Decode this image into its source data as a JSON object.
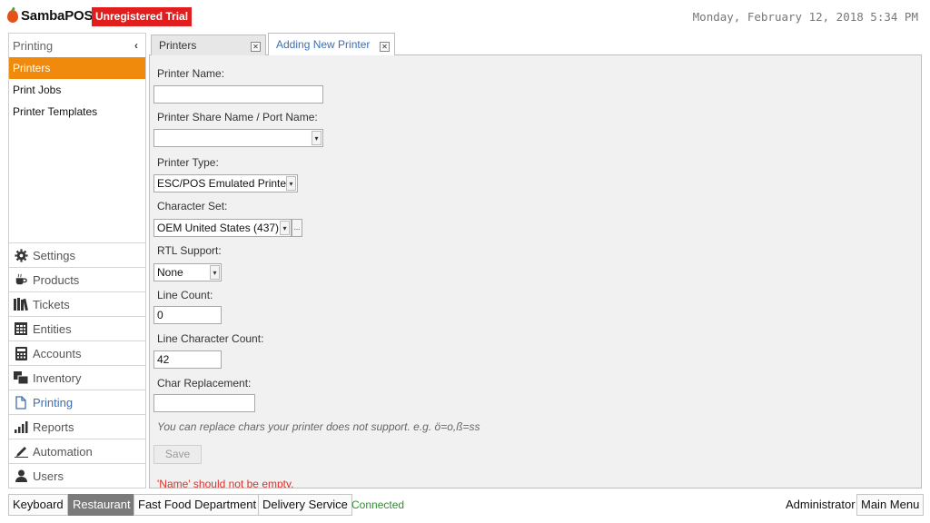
{
  "app": {
    "logo_text": "SambaPOS",
    "trial_badge": "Unregistered Trial",
    "datetime": "Monday, February 12, 2018 5:34 PM"
  },
  "sidebar": {
    "title": "Printing",
    "collapse_icon": "chevron-left",
    "items": [
      {
        "label": "Printers",
        "active": true
      },
      {
        "label": "Print Jobs",
        "active": false
      },
      {
        "label": "Printer Templates",
        "active": false
      }
    ],
    "categories": [
      {
        "label": "Settings",
        "icon": "gear-icon"
      },
      {
        "label": "Products",
        "icon": "coffee-cup-icon"
      },
      {
        "label": "Tickets",
        "icon": "books-icon"
      },
      {
        "label": "Entities",
        "icon": "table-grid-icon"
      },
      {
        "label": "Accounts",
        "icon": "calculator-icon"
      },
      {
        "label": "Inventory",
        "icon": "boxes-icon"
      },
      {
        "label": "Printing",
        "icon": "document-icon"
      },
      {
        "label": "Reports",
        "icon": "bar-chart-icon"
      },
      {
        "label": "Automation",
        "icon": "pen-icon"
      },
      {
        "label": "Users",
        "icon": "user-icon"
      }
    ]
  },
  "tabs": [
    {
      "label": "Printers"
    },
    {
      "label": "Adding New Printer"
    }
  ],
  "form": {
    "printer_name_label": "Printer Name:",
    "printer_name_value": "",
    "share_name_label": "Printer Share Name / Port Name:",
    "share_name_value": "",
    "printer_type_label": "Printer Type:",
    "printer_type_value": "ESC/POS Emulated Printer",
    "charset_label": "Character Set:",
    "charset_value": "OEM United States (437)",
    "charset_more": "...",
    "rtl_label": "RTL Support:",
    "rtl_value": "None",
    "line_count_label": "Line Count:",
    "line_count_value": "0",
    "line_char_count_label": "Line Character Count:",
    "line_char_count_value": "42",
    "char_replacement_label": "Char Replacement:",
    "char_replacement_value": "",
    "hint": "You can replace chars your printer does not support. e.g. ö=o,ß=ss",
    "save_label": "Save",
    "error": "'Name' should not be empty."
  },
  "footer": {
    "buttons": [
      "Keyboard",
      "Restaurant",
      "Fast Food Department",
      "Delivery Service"
    ],
    "active_button": "Restaurant",
    "status": "Connected",
    "user": "Administrator",
    "main_menu": "Main Menu"
  },
  "colors": {
    "accent": "#f08a0d",
    "trial_badge": "#e01e1e",
    "link_blue": "#3a6fb5",
    "status_green": "#2f8f2f",
    "error_red": "#d9342b"
  }
}
